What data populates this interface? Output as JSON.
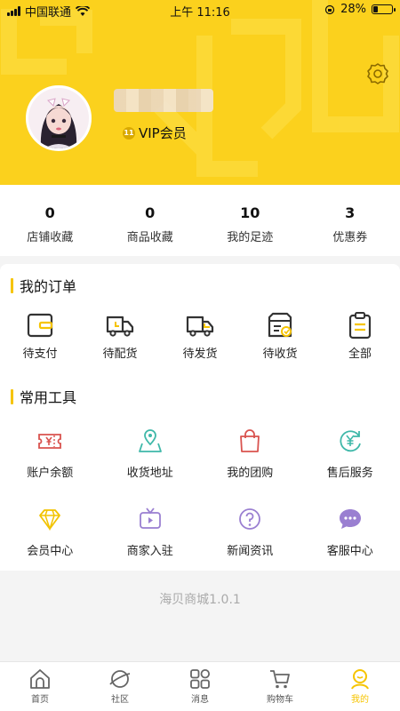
{
  "status_bar": {
    "carrier": "中国联通",
    "time": "上午 11:16",
    "battery_percent_label": "28%",
    "battery_level": 0.28
  },
  "profile": {
    "vip_badge": "11",
    "vip_label": "VIP会员"
  },
  "stats": [
    {
      "value": "0",
      "label": "店铺收藏"
    },
    {
      "value": "0",
      "label": "商品收藏"
    },
    {
      "value": "10",
      "label": "我的足迹"
    },
    {
      "value": "3",
      "label": "优惠券"
    }
  ],
  "orders": {
    "title": "我的订单",
    "items": [
      {
        "label": "待支付",
        "icon": "wallet-icon"
      },
      {
        "label": "待配货",
        "icon": "truck-icon"
      },
      {
        "label": "待发货",
        "icon": "delivery-truck-icon"
      },
      {
        "label": "待收货",
        "icon": "package-icon"
      },
      {
        "label": "全部",
        "icon": "clipboard-icon"
      }
    ]
  },
  "tools": {
    "title": "常用工具",
    "items": [
      {
        "label": "账户余额",
        "icon": "ticket-icon"
      },
      {
        "label": "收货地址",
        "icon": "map-pin-icon"
      },
      {
        "label": "我的团购",
        "icon": "shopping-bag-icon"
      },
      {
        "label": "售后服务",
        "icon": "yen-refresh-icon"
      },
      {
        "label": "会员中心",
        "icon": "diamond-icon"
      },
      {
        "label": "商家入驻",
        "icon": "tv-icon"
      },
      {
        "label": "新闻资讯",
        "icon": "question-icon"
      },
      {
        "label": "客服中心",
        "icon": "chat-bubble-icon"
      }
    ]
  },
  "version": "海贝商城1.0.1",
  "tabbar": {
    "items": [
      {
        "label": "首页",
        "icon": "home-icon"
      },
      {
        "label": "社区",
        "icon": "planet-icon"
      },
      {
        "label": "消息",
        "icon": "grid-icon"
      },
      {
        "label": "购物车",
        "icon": "cart-icon"
      },
      {
        "label": "我的",
        "icon": "user-icon"
      }
    ],
    "active_index": 4
  },
  "colors": {
    "brand_yellow": "#fbd11d",
    "accent": "#f6c400",
    "tool_red": "#d9534f",
    "tool_teal": "#3fb8a9",
    "tool_purple": "#9a7fd1",
    "tool_gold": "#f2c300"
  }
}
